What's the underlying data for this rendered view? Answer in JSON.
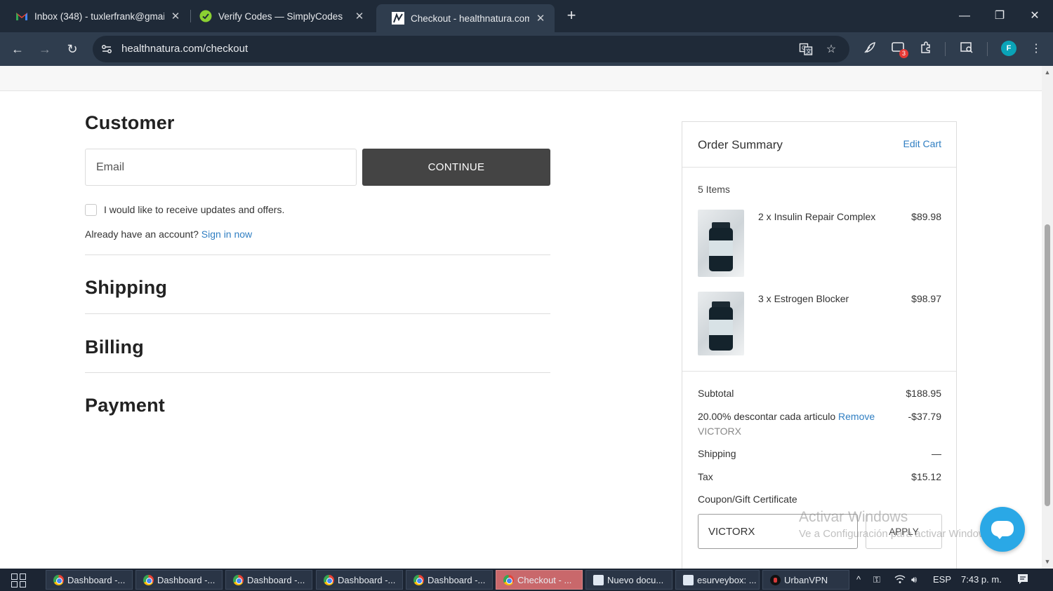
{
  "browser": {
    "tabs": [
      {
        "title": "Inbox (348) - tuxlerfrank@gmai",
        "icon": "gmail-icon",
        "active": false
      },
      {
        "title": "Verify Codes — SimplyCodes",
        "icon": "simplycodes-icon",
        "active": false
      },
      {
        "title": "Checkout - healthnatura.com",
        "icon": "healthnatura-icon",
        "active": true
      }
    ],
    "url": "healthnatura.com/checkout",
    "extension_badge": "3",
    "profile_initial": "F"
  },
  "checkout": {
    "customer": {
      "title": "Customer",
      "email_placeholder": "Email",
      "continue_label": "CONTINUE",
      "newsletter_label": "I would like to receive updates and offers.",
      "account_prompt": "Already have an account?",
      "sign_in_label": "Sign in now"
    },
    "shipping_title": "Shipping",
    "billing_title": "Billing",
    "payment_title": "Payment"
  },
  "summary": {
    "title": "Order Summary",
    "edit_label": "Edit Cart",
    "items_count": "5 Items",
    "items": [
      {
        "name": "2 x Insulin Repair Complex",
        "price": "$89.98"
      },
      {
        "name": "3 x Estrogen Blocker",
        "price": "$98.97"
      }
    ],
    "subtotal_label": "Subtotal",
    "subtotal_value": "$188.95",
    "discount_label": "20.00% descontar cada articulo",
    "discount_remove": "Remove",
    "discount_code": "VICTORX",
    "discount_value": "-$37.79",
    "shipping_label": "Shipping",
    "shipping_value": "—",
    "tax_label": "Tax",
    "tax_value": "$15.12",
    "coupon_label": "Coupon/Gift Certificate",
    "coupon_value": "VICTORX",
    "apply_label": "APPLY"
  },
  "watermark": {
    "line1": "Activar Windows",
    "line2": "Ve a Configuración para activar Windows."
  },
  "taskbar": {
    "items": [
      {
        "label": "Dashboard -...",
        "icon": "chrome-icon"
      },
      {
        "label": "Dashboard -...",
        "icon": "chrome-icon"
      },
      {
        "label": "Dashboard -...",
        "icon": "chrome-icon"
      },
      {
        "label": "Dashboard -...",
        "icon": "chrome-icon"
      },
      {
        "label": "Dashboard -...",
        "icon": "chrome-icon"
      },
      {
        "label": "Checkout - ...",
        "icon": "chrome-icon"
      },
      {
        "label": "Nuevo docu...",
        "icon": "document-icon"
      },
      {
        "label": "esurveybox: ...",
        "icon": "document-icon"
      },
      {
        "label": "UrbanVPN",
        "icon": "urbanvpn-icon"
      }
    ],
    "language": "ESP",
    "time": "7:43 p. m."
  }
}
